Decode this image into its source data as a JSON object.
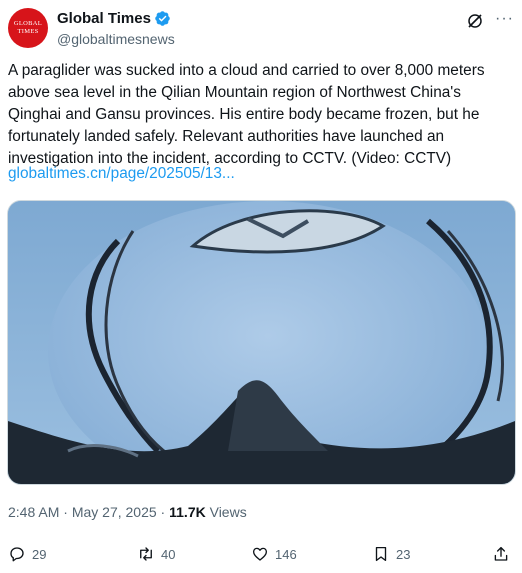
{
  "account": {
    "avatar_line1": "GLOBAL",
    "avatar_line2": "TIMES",
    "display_name": "Global Times",
    "handle": "@globaltimesnews",
    "verified_color": "#1d9bf0",
    "avatar_color": "#d7141a"
  },
  "tweet": {
    "text": "A paraglider was sucked into a cloud and carried to over 8,000 meters above sea level in the Qilian Mountain region of Northwest China's Qinghai and Gansu provinces. His entire body became frozen, but he fortunately landed safely. Relevant authorities have launched an investigation into the incident, according to CCTV. (Video: CCTV)",
    "link_text": "globaltimes.cn/page/202505/13...",
    "link_color": "#1d9bf0"
  },
  "meta": {
    "time": "2:48 AM",
    "separator": " · ",
    "date": "May 27, 2025",
    "views_count": "11.7K",
    "views_label": " Views"
  },
  "actions": {
    "replies": "29",
    "reposts": "40",
    "likes": "146",
    "bookmarks": "23"
  },
  "icons": [
    "verified-badge-icon",
    "grok-icon",
    "more-icon",
    "reply-icon",
    "repost-icon",
    "like-icon",
    "bookmark-icon",
    "share-icon"
  ]
}
